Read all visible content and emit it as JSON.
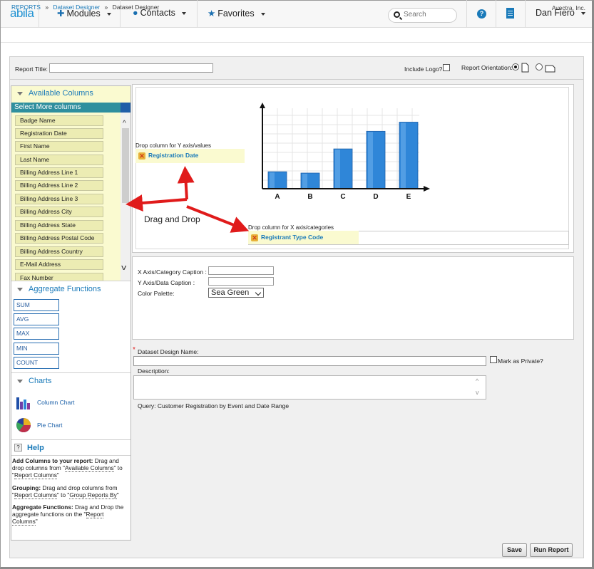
{
  "nav": {
    "brand": "abila",
    "modules": "Modules",
    "contacts": "Contacts",
    "favorites": "Favorites",
    "search_placeholder": "Search",
    "user": "Dan Fiero",
    "icons": [
      "puzzle-icon",
      "person-icon",
      "star-icon",
      "search-icon",
      "help-icon",
      "building-icon"
    ]
  },
  "breadcrumb": {
    "items": [
      "REPORTS",
      "Dataset Designer",
      "Dataset Designer"
    ],
    "separator": "»",
    "company": "Avectra, Inc."
  },
  "report": {
    "title_label": "Report Title:",
    "logo_label": "Include Logo?",
    "orientation_label": "Report Orientation:"
  },
  "available": {
    "heading": "Available Columns",
    "select_more": "Select More columns",
    "columns": [
      "Badge Name",
      "Registration Date",
      "First Name",
      "Last Name",
      "Billing Address Line 1",
      "Billing Address Line 2",
      "Billing Address Line 3",
      "Billing Address City",
      "Billing Address State",
      "Billing Address Postal Code",
      "Billing Address Country",
      "E-Mail Address",
      "Fax Number"
    ]
  },
  "aggregate": {
    "heading": "Aggregate Functions",
    "items": [
      "SUM",
      "AVG",
      "MAX",
      "MIN",
      "COUNT"
    ]
  },
  "charts": {
    "heading": "Charts",
    "column_chart": "Column Chart",
    "pie_chart": "Pie Chart"
  },
  "help": {
    "heading": "Help",
    "p1_bold": "Add Columns to your report:",
    "p1_a": " Drag and drop columns from \"",
    "p1_u1": "Available Columns",
    "p1_b": "\" to \"",
    "p1_u2": "Report Columns",
    "p1_c": "\"",
    "p2_bold": "Grouping:",
    "p2_a": " Drag and drop columns from \"",
    "p2_u1": "Report Columns",
    "p2_b": "\" to \"",
    "p2_u2": "Group Reports By",
    "p2_c": "\"",
    "p3_bold": "Aggregate Functions:",
    "p3_a": " Drag and Drop the aggregate functions on the \"",
    "p3_u1": "Report Columns",
    "p3_c": "\""
  },
  "chart_area": {
    "y_drop_label": "Drop column for Y axis/values",
    "y_value": "Registration Date",
    "x_drop_label": "Drop column for X axis/categories",
    "x_value": "Registrant Type Code",
    "annotation": "Drag and Drop",
    "arrow_color": "#e01b1b"
  },
  "chart_data": {
    "type": "bar",
    "categories": [
      "A",
      "B",
      "C",
      "D",
      "E"
    ],
    "values": [
      26,
      24,
      61,
      88,
      102
    ],
    "ylim": [
      0,
      120
    ],
    "grid": true,
    "bar_color": "#2f86d8"
  },
  "settings": {
    "x_caption_label": "X Axis/Category Caption :",
    "y_caption_label": "Y Axis/Data Caption :",
    "palette_label": "Color Palette:",
    "palette_value": "Sea Green"
  },
  "design": {
    "required_mark": "*",
    "name_label": "Dataset Design Name:",
    "private_label": "Mark as Private?",
    "description_label": "Description:",
    "query": "Query: Customer Registration by Event and Date Range"
  },
  "actions": {
    "save": "Save",
    "run": "Run Report"
  }
}
